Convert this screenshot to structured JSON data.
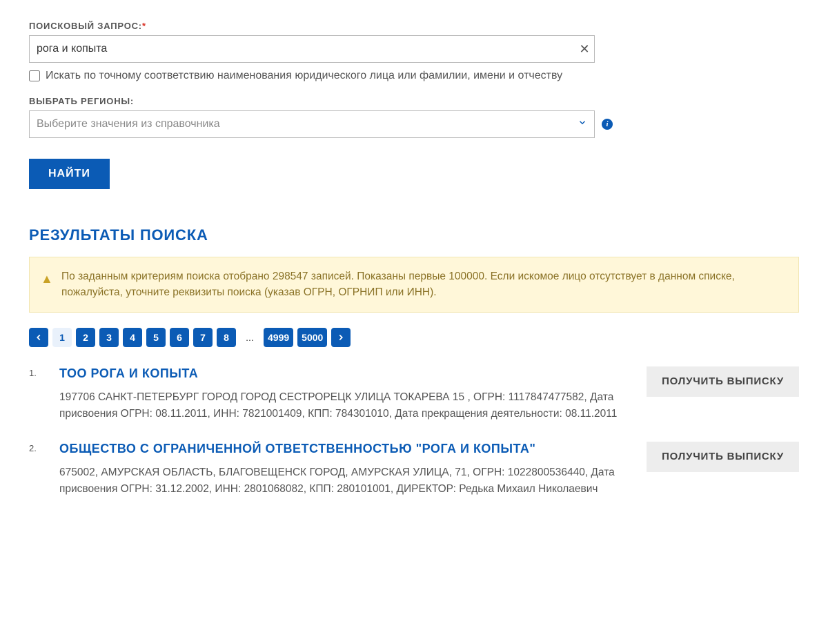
{
  "form": {
    "query_label": "ПОИСКОВЫЙ ЗАПРОС:",
    "required_mark": "*",
    "query_value": "рога и копыта",
    "exact_match_label": "Искать по точному соответствию наименования юридического лица или фамилии, имени и отчеству",
    "region_label": "ВЫБРАТЬ РЕГИОНЫ:",
    "region_placeholder": "Выберите значения из справочника",
    "submit_label": "НАЙТИ"
  },
  "results": {
    "heading": "РЕЗУЛЬТАТЫ ПОИСКА",
    "alert_text": "По заданным критериям поиска отобрано 298547 записей. Показаны первые 100000. Если искомое лицо отсутствует в данном списке, пожалуйста, уточните реквизиты поиска (указав ОГРН, ОГРНИП или ИНН).",
    "pagination": {
      "current": "1",
      "pages": [
        "2",
        "3",
        "4",
        "5",
        "6",
        "7",
        "8"
      ],
      "ellipsis": "...",
      "last_pages": [
        "4999",
        "5000"
      ]
    },
    "excerpt_button": "ПОЛУЧИТЬ ВЫПИСКУ",
    "items": [
      {
        "index": "1.",
        "title": "ТОО РОГА И КОПЫТА",
        "desc": "197706 САНКТ-ПЕТЕРБУРГ ГОРОД ГОРОД СЕСТРОРЕЦК УЛИЦА ТОКАРЕВА 15 , ОГРН: 1117847477582, Дата присвоения ОГРН: 08.11.2011, ИНН: 7821001409, КПП: 784301010, Дата прекращения деятельности: 08.11.2011"
      },
      {
        "index": "2.",
        "title": "ОБЩЕСТВО С ОГРАНИЧЕННОЙ ОТВЕТСТВЕННОСТЬЮ \"РОГА И КОПЫТА\"",
        "desc": "675002, АМУРСКАЯ ОБЛАСТЬ, БЛАГОВЕЩЕНСК ГОРОД, АМУРСКАЯ УЛИЦА, 71, ОГРН: 1022800536440, Дата присвоения ОГРН: 31.12.2002, ИНН: 2801068082, КПП: 280101001, ДИРЕКТОР: Редька Михаил Николаевич"
      }
    ]
  }
}
